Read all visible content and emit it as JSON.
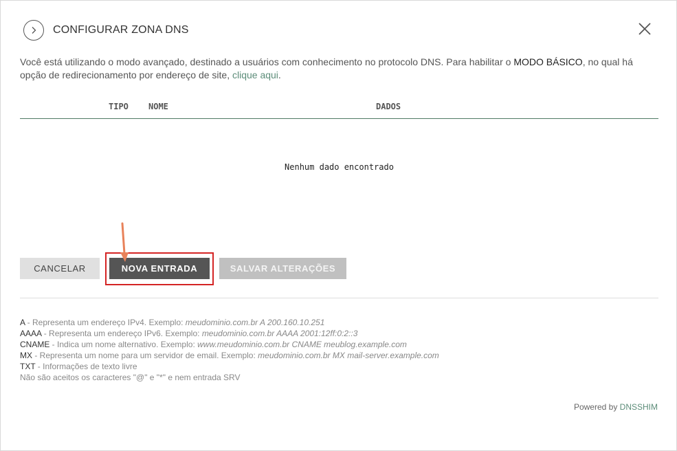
{
  "header": {
    "title": "CONFIGURAR ZONA DNS"
  },
  "intro": {
    "text_1": "Você está utilizando o modo avançado, destinado a usuários com conhecimento no protocolo DNS. Para habilitar o ",
    "mode": "MODO BÁSICO",
    "text_2": ", no qual há opção de redirecionamento por endereço de site, ",
    "link": "clique aqui",
    "text_3": "."
  },
  "table": {
    "columns": [
      "TIPO",
      "NOME",
      "DADOS"
    ],
    "empty_message": "Nenhum dado encontrado"
  },
  "buttons": {
    "cancel": "CANCELAR",
    "new_entry": "NOVA ENTRADA",
    "save": "SALVAR ALTERAÇÕES"
  },
  "legend": [
    {
      "code": "A",
      "desc": " - Representa um endereço IPv4. Exemplo: ",
      "example": "meudominio.com.br A 200.160.10.251"
    },
    {
      "code": "AAAA",
      "desc": " - Representa um endereço IPv6. Exemplo: ",
      "example": "meudominio.com.br AAAA 2001:12ff:0:2::3"
    },
    {
      "code": "CNAME",
      "desc": " - Indica um nome alternativo. Exemplo: ",
      "example": "www.meudominio.com.br CNAME meublog.example.com"
    },
    {
      "code": "MX",
      "desc": " - Representa um nome para um servidor de email. Exemplo: ",
      "example": "meudominio.com.br MX mail-server.example.com"
    },
    {
      "code": "TXT",
      "desc": " - Informações de texto livre",
      "example": ""
    }
  ],
  "note": "Não são aceitos os caracteres \"@\" e \"*\" e nem entrada SRV",
  "footer": {
    "powered_by": "Powered by ",
    "brand": "DNSSHIM"
  },
  "colors": {
    "accent": "#5b8c78",
    "highlight": "#d42424",
    "arrow": "#e8825a"
  },
  "icons": {
    "back": "chevron-right-icon",
    "close": "close-icon",
    "arrow": "arrow-down-icon"
  }
}
